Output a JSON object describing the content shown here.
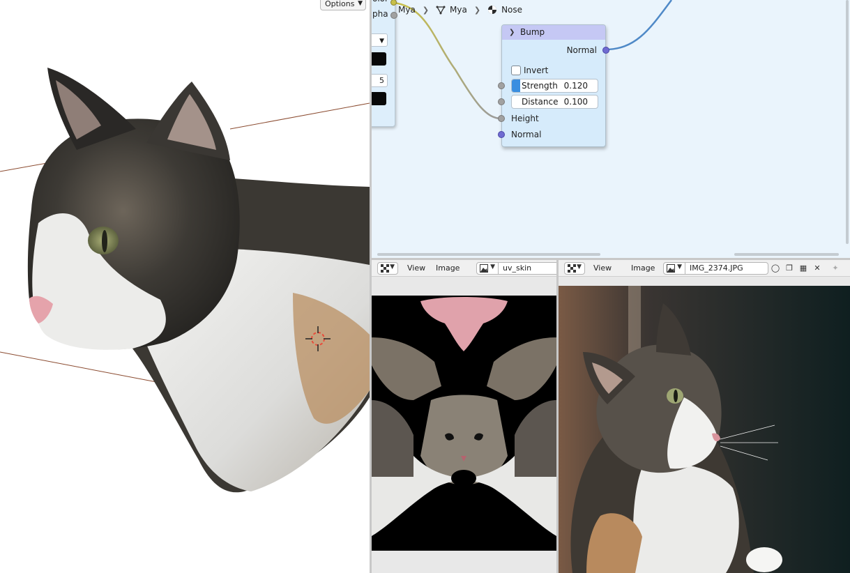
{
  "viewport": {
    "options_label": "Options"
  },
  "node_editor": {
    "breadcrumb": [
      {
        "label": "Mya",
        "icon": "object-icon"
      },
      {
        "label": "Mya",
        "icon": "mesh-icon"
      },
      {
        "label": "Nose",
        "icon": "material-icon"
      }
    ],
    "left_node": {
      "color_label": "olor",
      "alpha_label": "pha",
      "field_value": "5",
      "swatch_color": "#080808"
    },
    "bump_node": {
      "title": "Bump",
      "header_color": "#c5c8f4",
      "output_normal": "Normal",
      "invert_label": "Invert",
      "strength_label": "Strength",
      "strength_value": "0.120",
      "distance_label": "Distance",
      "distance_value": "0.100",
      "height_label": "Height",
      "normal_label": "Normal"
    }
  },
  "uv_editor": {
    "menu_view": "View",
    "menu_image": "Image",
    "image_name": "uv_skin"
  },
  "ref_editor": {
    "menu_view": "View",
    "menu_image": "Image",
    "image_name": "IMG_2374.JPG"
  },
  "colors": {
    "accent_blue": "#3a8ee0",
    "node_bg": "#eaf4fc",
    "socket_vector": "#6f6bd1",
    "socket_float": "#a1a1a1",
    "link_blue": "#4f89c7",
    "link_yellow": "#c8c04a"
  }
}
